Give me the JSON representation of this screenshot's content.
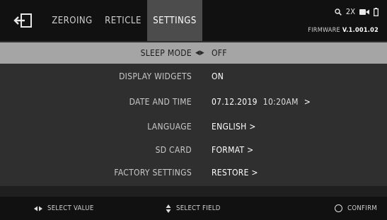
{
  "header": {
    "tabs": [
      {
        "label": "ZEROING"
      },
      {
        "label": "RETICLE"
      },
      {
        "label": "SETTINGS",
        "active": true
      }
    ],
    "status": {
      "zoom": "2X",
      "icons": [
        "magnifier-icon",
        "camera-icon",
        "battery-icon"
      ]
    },
    "firmware_prefix": "FIRMWARE ",
    "firmware_version": "V.1.001.02"
  },
  "settings": {
    "rows": [
      {
        "label": "SLEEP MODE",
        "value": "OFF",
        "selected": true
      },
      {
        "label": "DISPLAY WIDGETS",
        "value": "ON"
      },
      {
        "label": "DATE AND TIME",
        "value": "07.12.2019",
        "time": "10:20AM",
        "suffix": ">"
      },
      {
        "label": "LANGUAGE",
        "value": "ENGLISH >"
      },
      {
        "label": "SD CARD",
        "value": "FORMAT >"
      },
      {
        "label": "FACTORY SETTINGS",
        "value": "RESTORE >"
      }
    ]
  },
  "footer": {
    "select_value": "SELECT VALUE",
    "select_field": "SELECT FIELD",
    "confirm": "CONFIRM"
  },
  "colors": {
    "top_bar": "#111111",
    "active_tab": "#4c4c4c",
    "selected_row": "#a5a5a5",
    "content_bg": "#2f2f2f"
  }
}
